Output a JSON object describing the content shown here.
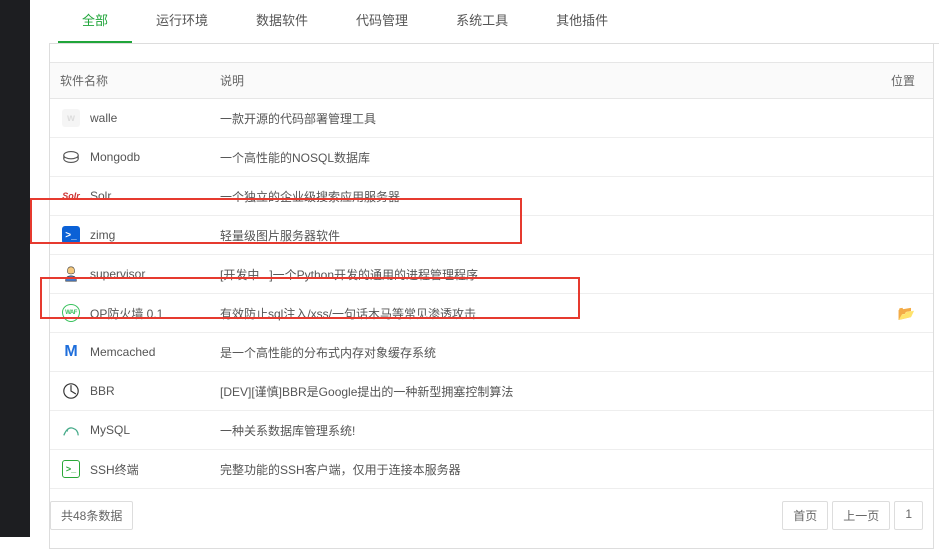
{
  "tabs": [
    {
      "label": "全部",
      "active": true
    },
    {
      "label": "运行环境"
    },
    {
      "label": "数据软件"
    },
    {
      "label": "代码管理"
    },
    {
      "label": "系统工具"
    },
    {
      "label": "其他插件"
    }
  ],
  "headers": {
    "name": "软件名称",
    "desc": "说明",
    "loc": "位置"
  },
  "rows": [
    {
      "icon": "walle",
      "name": "walle",
      "desc": "一款开源的代码部署管理工具",
      "loc": ""
    },
    {
      "icon": "mongodb",
      "name": "Mongodb",
      "desc": "一个高性能的NOSQL数据库",
      "loc": ""
    },
    {
      "icon": "solr",
      "name": "Solr",
      "desc": "一个独立的企业级搜索应用服务器",
      "loc": ""
    },
    {
      "icon": "zimg",
      "name": "zimg",
      "desc": "轻量级图片服务器软件",
      "loc": ""
    },
    {
      "icon": "supervisor",
      "name": "supervisor",
      "desc": "[开发中...]一个Python开发的通用的进程管理程序",
      "loc": ""
    },
    {
      "icon": "waf",
      "name": "OP防火墙 0.1",
      "desc": "有效防止sql注入/xss/一句话木马等常见渗透攻击",
      "loc": "folder"
    },
    {
      "icon": "memcached",
      "name": "Memcached",
      "desc": "是一个高性能的分布式内存对象缓存系统",
      "loc": ""
    },
    {
      "icon": "bbr",
      "name": "BBR",
      "desc": "[DEV][谨慎]BBR是Google提出的一种新型拥塞控制算法",
      "loc": ""
    },
    {
      "icon": "mysql",
      "name": "MySQL",
      "desc": "一种关系数据库管理系统!",
      "loc": ""
    },
    {
      "icon": "ssh",
      "name": "SSH终端",
      "desc": "完整功能的SSH客户端，仅用于连接本服务器",
      "loc": ""
    }
  ],
  "footer": {
    "count": "共48条数据",
    "first": "首页",
    "prev": "上一页",
    "next": "1"
  }
}
